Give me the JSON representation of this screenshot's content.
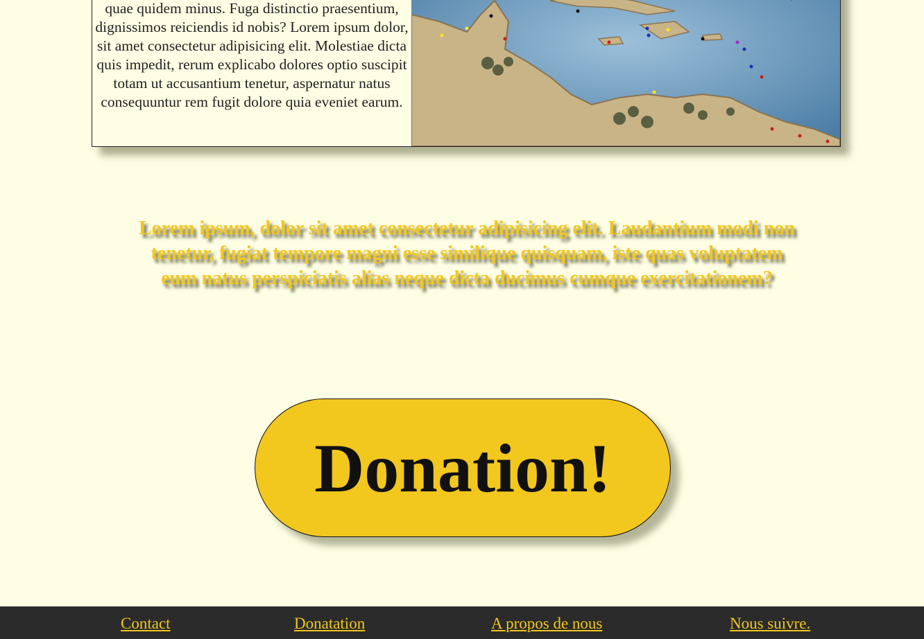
{
  "card": {
    "text": "quae quidem minus. Fuga distinctio praesentium, dignissimos reiciendis id nobis? Lorem ipsum dolor, sit amet consectetur adipisicing elit. Molestiae dicta quis impedit, rerum explicabo dolores optio suscipit totam ut accusantium tenetur, aspernatur natus consequuntur rem fugit dolore quia eveniet earum."
  },
  "tagline": "Lorem ipsum, dolor sit amet consectetur adipisicing elit. Laudantium modi non tenetur, fugiat tempore magni esse similique quisquam, iste quas voluptatem eum natus perspiciatis alias neque dicta ducimus cumque exercitationem?",
  "donate": {
    "label": "Donation!"
  },
  "footer": {
    "links": [
      "Contact",
      "Donatation",
      "A propos de nous",
      "Nous suivre."
    ]
  },
  "colors": {
    "accent": "#f2c71e",
    "background": "#fefee4",
    "footer": "#2b2b2b"
  }
}
